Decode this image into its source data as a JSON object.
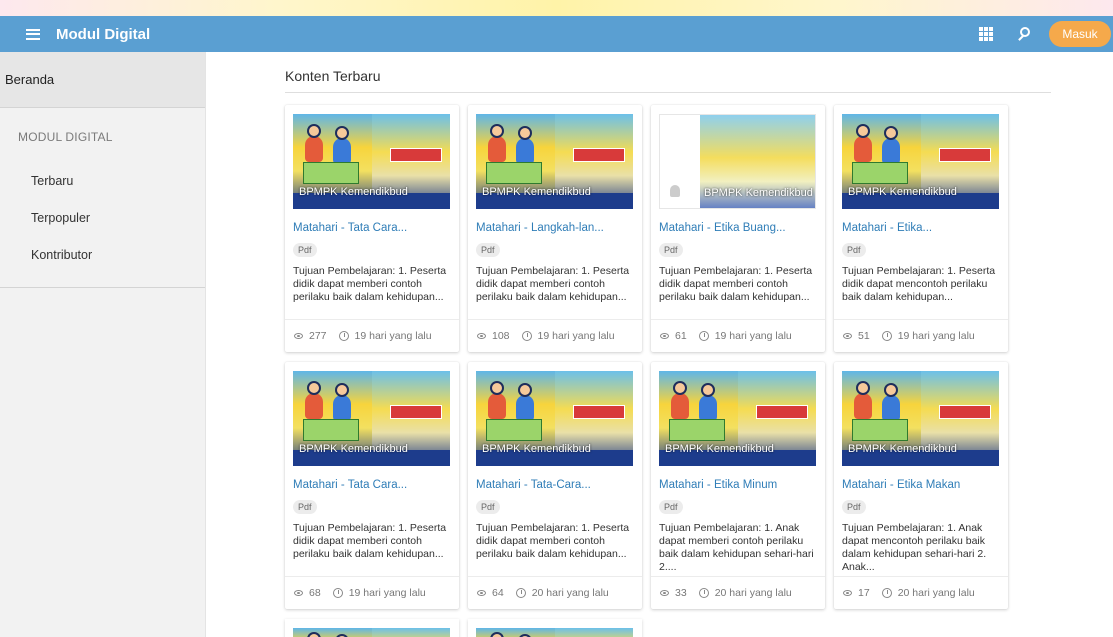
{
  "appbar": {
    "title": "Modul Digital",
    "login_label": "Masuk",
    "menu_icon": "hamburger-icon",
    "apps_icon": "apps-grid-icon",
    "search_icon": "search-icon",
    "color": "#5a9fd2",
    "login_color": "#f5a94b"
  },
  "sidebar": {
    "home_label": "Beranda",
    "section_title": "MODUL DIGITAL",
    "items": [
      {
        "label": "Terbaru"
      },
      {
        "label": "Terpopuler"
      },
      {
        "label": "Kontributor"
      }
    ]
  },
  "main": {
    "heading": "Konten Terbaru",
    "cards": [
      {
        "title": "Matahari - Tata Cara...",
        "badge": "Pdf",
        "credit": "BPMPK Kemendikbud",
        "desc": "Tujuan Pembelajaran: 1. Peserta didik dapat memberi contoh perilaku baik dalam kehidupan...",
        "views": "277",
        "time": "19 hari yang lalu"
      },
      {
        "title": "Matahari - Langkah-lan...",
        "badge": "Pdf",
        "credit": "BPMPK Kemendikbud",
        "desc": "Tujuan Pembelajaran: 1. Peserta didik dapat memberi contoh perilaku baik dalam kehidupan...",
        "views": "108",
        "time": "19 hari yang lalu"
      },
      {
        "title": "Matahari - Etika Buang...",
        "badge": "Pdf",
        "credit": "BPMPK Kemendikbud",
        "desc": "Tujuan Pembelajaran: 1. Peserta didik dapat memberi contoh perilaku baik dalam kehidupan...",
        "views": "61",
        "time": "19 hari yang lalu"
      },
      {
        "title": "Matahari - Etika...",
        "badge": "Pdf",
        "credit": "BPMPK Kemendikbud",
        "desc": "Tujuan Pembelajaran: 1. Peserta didik dapat mencontoh perilaku baik dalam kehidupan...",
        "views": "51",
        "time": "19 hari yang lalu"
      },
      {
        "title": "Matahari - Tata Cara...",
        "badge": "Pdf",
        "credit": "BPMPK Kemendikbud",
        "desc": "Tujuan Pembelajaran: 1. Peserta didik dapat memberi contoh perilaku baik dalam kehidupan...",
        "views": "68",
        "time": "19 hari yang lalu"
      },
      {
        "title": "Matahari - Tata-Cara...",
        "badge": "Pdf",
        "credit": "BPMPK Kemendikbud",
        "desc": "Tujuan Pembelajaran: 1. Peserta didik dapat memberi contoh perilaku baik dalam kehidupan...",
        "views": "64",
        "time": "20 hari yang lalu"
      },
      {
        "title": "Matahari - Etika Minum",
        "badge": "Pdf",
        "credit": "BPMPK Kemendikbud",
        "desc": "Tujuan Pembelajaran: 1. Anak dapat memberi contoh perilaku baik dalam kehidupan sehari-hari 2....",
        "views": "33",
        "time": "20 hari yang lalu"
      },
      {
        "title": "Matahari - Etika Makan",
        "badge": "Pdf",
        "credit": "BPMPK Kemendikbud",
        "desc": "Tujuan Pembelajaran: 1. Anak dapat mencontoh perilaku baik dalam kehidupan sehari-hari 2. Anak...",
        "views": "17",
        "time": "20 hari yang lalu"
      }
    ]
  }
}
